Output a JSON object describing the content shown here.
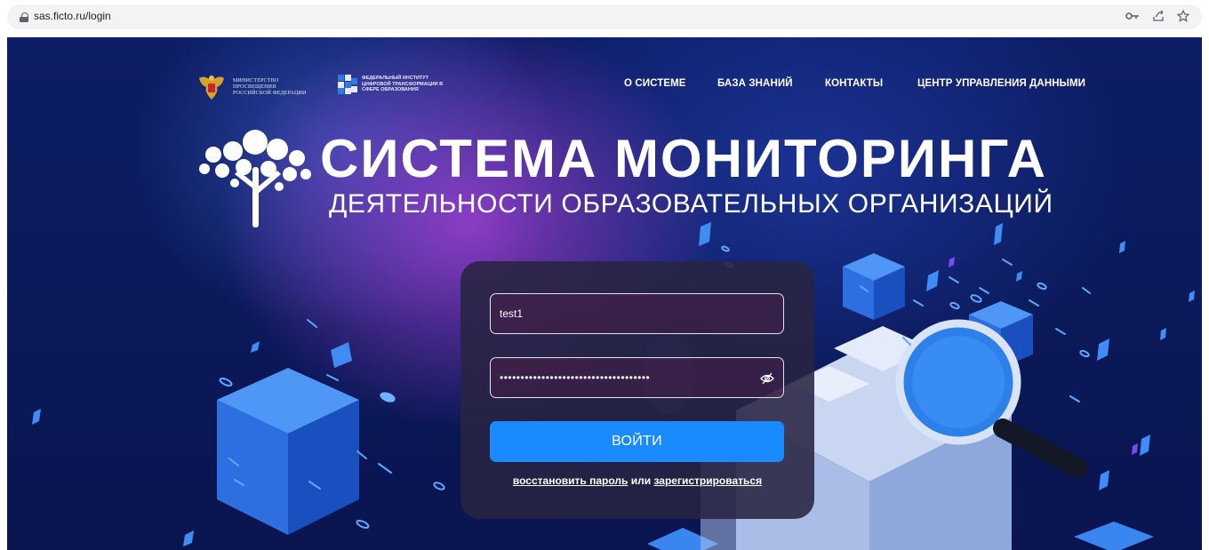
{
  "browser": {
    "url": "sas.ficto.ru/login",
    "icons": [
      "lock-icon",
      "key-icon",
      "share-icon",
      "star-icon"
    ]
  },
  "header": {
    "logo_ministry": "МИНИСТЕРСТВО ПРОСВЕЩЕНИЯ РОССИЙСКОЙ ФЕДЕРАЦИИ",
    "logo_institute": "ФЕДЕРАЛЬНЫЙ ИНСТИТУТ ЦИФРОВОЙ ТРАНСФОРМАЦИИ В СФЕРЕ ОБРАЗОВАНИЯ",
    "nav": [
      {
        "label": "О СИСТЕМЕ"
      },
      {
        "label": "БАЗА ЗНАНИЙ"
      },
      {
        "label": "КОНТАКТЫ"
      },
      {
        "label": "ЦЕНТР УПРАВЛЕНИЯ ДАННЫМИ"
      }
    ]
  },
  "hero": {
    "title": "СИСТЕМА МОНИТОРИНГА",
    "subtitle": "ДЕЯТЕЛЬНОСТИ ОБРАЗОВАТЕЛЬНЫХ ОРГАНИЗАЦИЙ"
  },
  "login": {
    "username_value": "test1",
    "password_value": "••••••••••••••••••••••••••••••••••••",
    "submit_label": "ВОЙТИ",
    "recover_label": "восстановить пароль",
    "or_label": "или",
    "register_label": "зарегистрироваться"
  },
  "colors": {
    "background": "#0b1a5c",
    "accent": "#1a8bff",
    "card": "#282442"
  }
}
